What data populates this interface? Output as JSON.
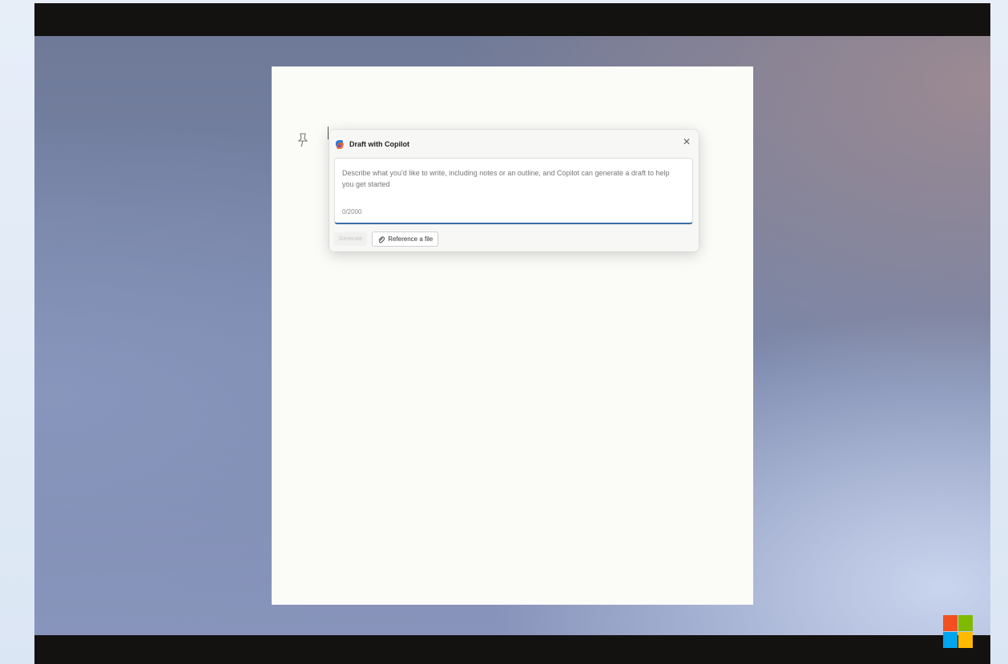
{
  "dialog": {
    "title": "Draft with Copilot",
    "close_icon": "close-icon",
    "prompt_placeholder": "Describe what you'd like to write, including notes or an outline, and Copilot can generate a draft to help you get started",
    "char_counter": "0/2000",
    "generate_label": "Generate",
    "reference_label": "Reference a file",
    "reference_icon": "paperclip-icon"
  },
  "icons": {
    "pin": "pin-icon",
    "copilot": "copilot-icon",
    "logo": "microsoft-logo"
  },
  "colors": {
    "accent_underline": "#3a6ea5",
    "logo_red": "#f25022",
    "logo_green": "#7fba00",
    "logo_blue": "#00a4ef",
    "logo_yellow": "#ffb900"
  }
}
